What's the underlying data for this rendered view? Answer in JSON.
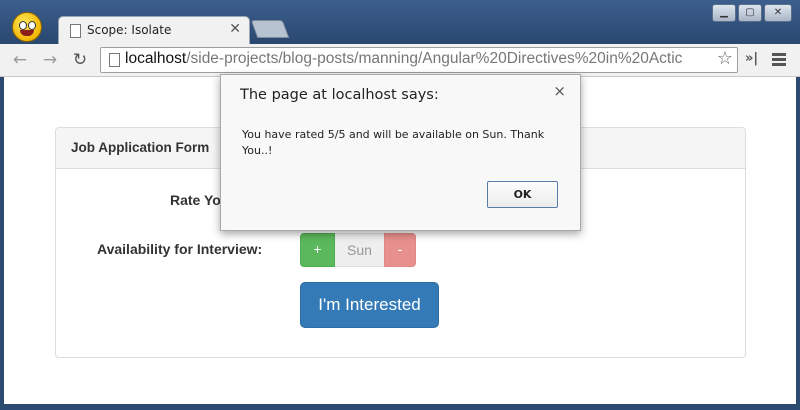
{
  "browser": {
    "tab": {
      "title": "Scope: Isolate"
    },
    "url": {
      "host": "localhost",
      "path": "/side-projects/blog-posts/manning/Angular%20Directives%20in%20Actic"
    },
    "window_controls": {
      "minimize": "▁",
      "maximize": "▢",
      "close": "✕"
    }
  },
  "page": {
    "panel_title": "Job Application Form",
    "rate_label": "Rate Yo",
    "availability_label": "Availability for Interview:",
    "day_picker": {
      "plus": "+",
      "value": "Sun",
      "minus": "-"
    },
    "submit_label": "I'm Interested"
  },
  "alert": {
    "title": "The page at localhost says:",
    "message": "You have rated 5/5 and will be available on Sun. Thank You..!",
    "ok_label": "OK",
    "close_symbol": "×"
  },
  "colors": {
    "success": "#5cb85c",
    "danger_light": "#e8908d",
    "primary": "#337ab7"
  }
}
